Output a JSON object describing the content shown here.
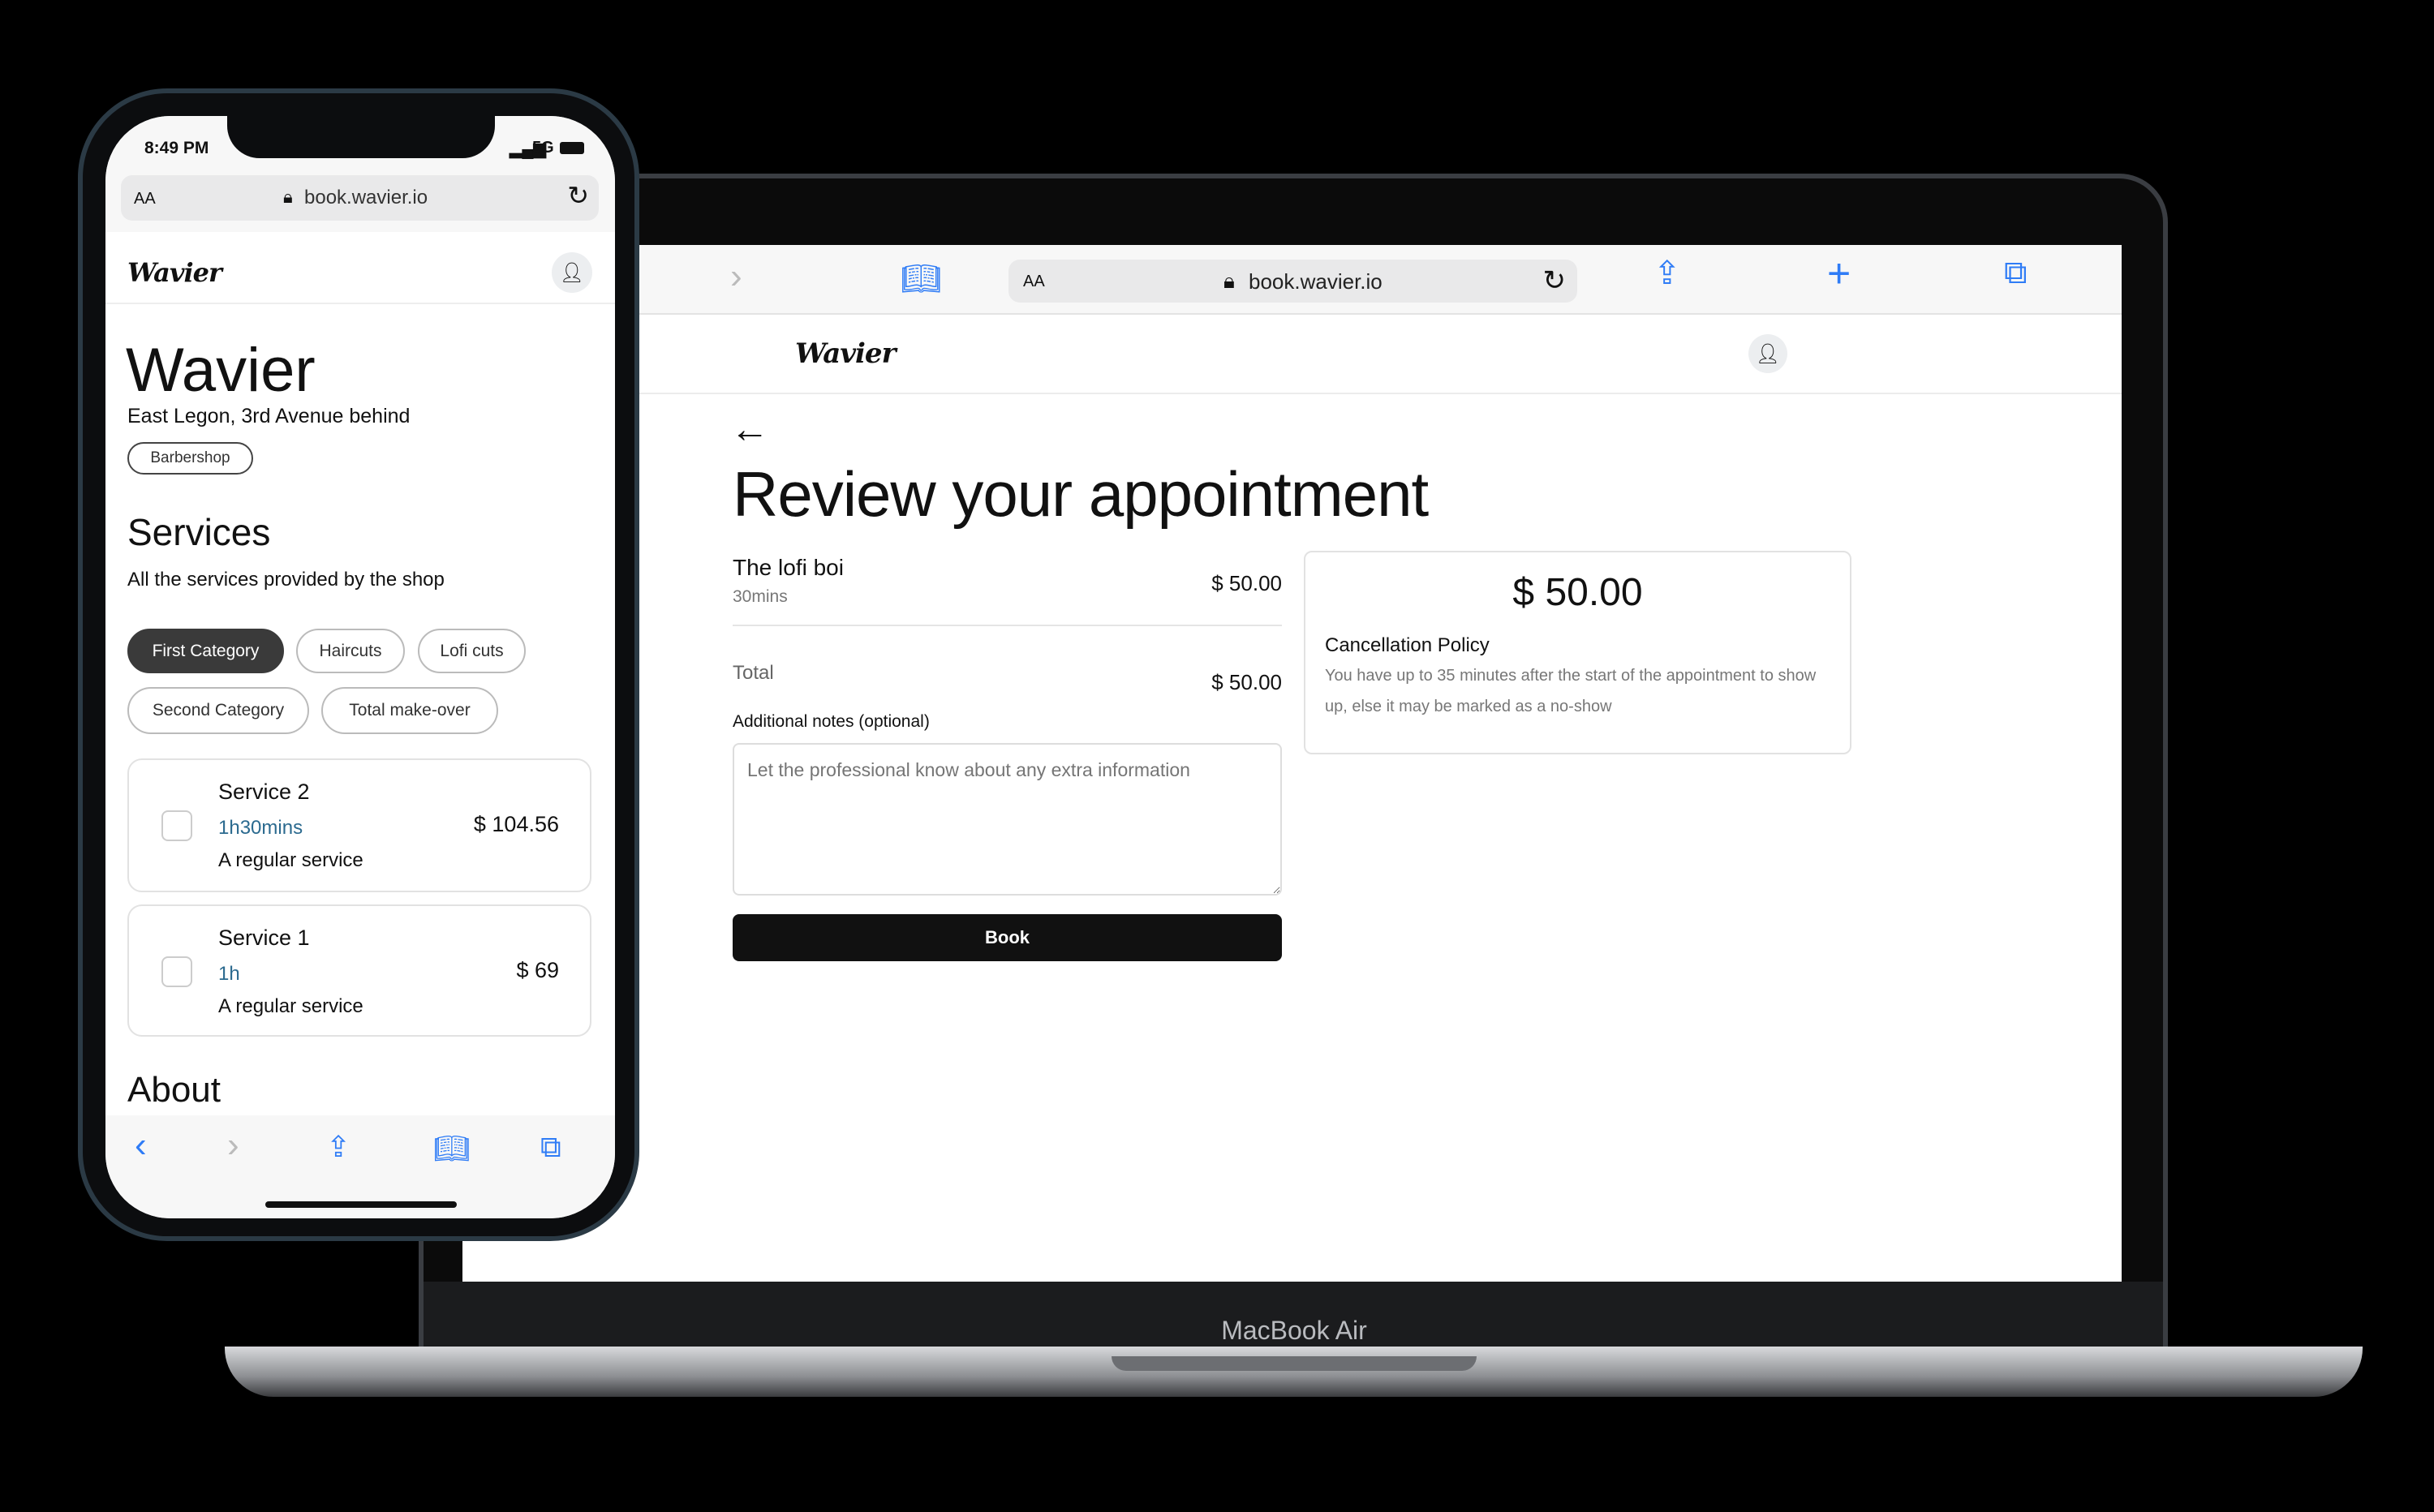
{
  "laptop": {
    "label": "MacBook Air",
    "browser": {
      "url": "book.wavier.io",
      "aa": "AA"
    },
    "header": {
      "logo": "Wavier"
    },
    "page": {
      "title": "Review your appointment",
      "item": {
        "name": "The lofi boi",
        "duration": "30mins",
        "price": "$ 50.00"
      },
      "total_label": "Total",
      "total_value": "$ 50.00",
      "notes_label": "Additional notes (optional)",
      "notes_placeholder": "Let the professional know about any extra information",
      "book_label": "Book",
      "summary": {
        "price": "$ 50.00",
        "policy_title": "Cancellation Policy",
        "policy_text": "You have up to 35 minutes after the start of the appointment to show up, else it may be marked as a no-show"
      }
    }
  },
  "phone": {
    "status": {
      "time": "8:49 PM",
      "network": "5G"
    },
    "browser": {
      "url": "book.wavier.io",
      "aa": "AA"
    },
    "header": {
      "logo": "Wavier"
    },
    "shop": {
      "name": "Wavier",
      "address": "East Legon, 3rd Avenue behind",
      "tag": "Barbershop"
    },
    "services": {
      "title": "Services",
      "subtitle": "All the services provided by the shop",
      "categories": [
        "First Category",
        "Haircuts",
        "Lofi cuts",
        "Second Category",
        "Total make-over"
      ],
      "active_category": "First Category",
      "items": [
        {
          "name": "Service 2",
          "duration": "1h30mins",
          "description": "A regular service",
          "price": "$ 104.56"
        },
        {
          "name": "Service 1",
          "duration": "1h",
          "description": "A regular service",
          "price": "$ 69"
        }
      ]
    },
    "about_title": "About"
  },
  "colors": {
    "accent": "#2f7cf6",
    "button": "#111111"
  }
}
